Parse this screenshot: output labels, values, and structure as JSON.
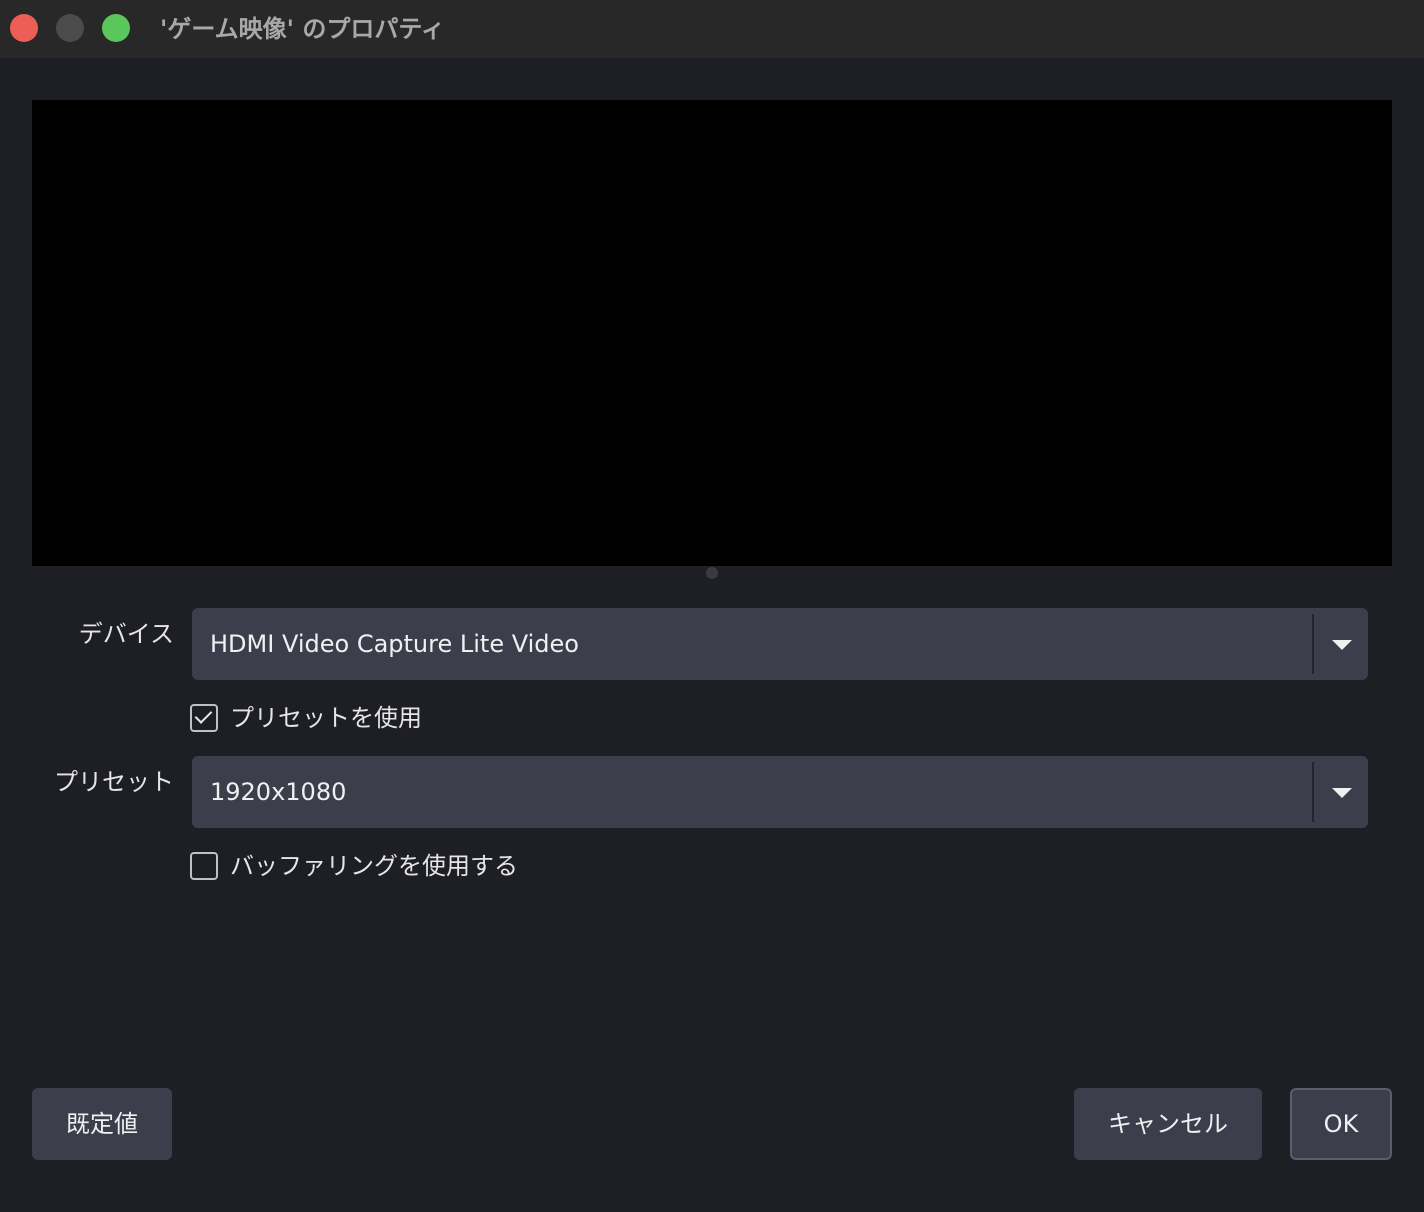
{
  "window": {
    "title": "'ゲーム映像' のプロパティ"
  },
  "form": {
    "device_label": "デバイス",
    "device_value": "HDMI Video Capture Lite Video",
    "use_preset_label": "プリセットを使用",
    "use_preset_checked": true,
    "preset_label": "プリセット",
    "preset_value": "1920x1080",
    "use_buffering_label": "バッファリングを使用する",
    "use_buffering_checked": false
  },
  "buttons": {
    "defaults": "既定値",
    "cancel": "キャンセル",
    "ok": "OK"
  },
  "colors": {
    "window_bg": "#1e1f24",
    "titlebar_bg": "#282828",
    "control_bg": "#3c3e4b",
    "close": "#ec5f57",
    "minimize": "#4b4b4b",
    "maximize": "#5bc65b"
  }
}
